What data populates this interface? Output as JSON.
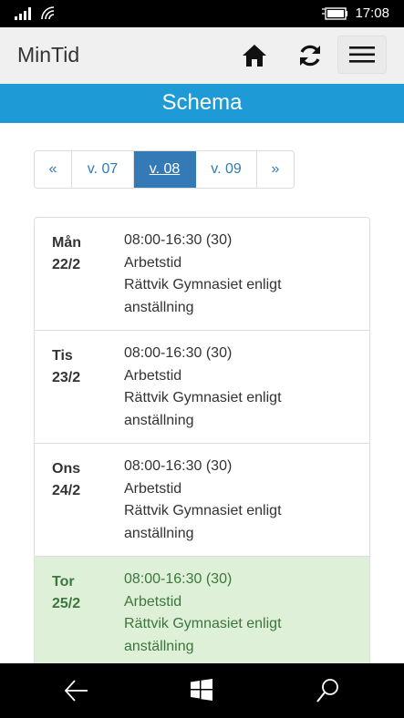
{
  "status_bar": {
    "time": "17:08"
  },
  "navbar": {
    "brand": "MinTid"
  },
  "page_title": "Schema",
  "pagination": {
    "prev": "«",
    "weeks": [
      "v. 07",
      "v. 08",
      "v. 09"
    ],
    "active_week": "v. 08",
    "next": "»"
  },
  "schedule": [
    {
      "day": "Mån",
      "date": "22/2",
      "time": "08:00-16:30 (30)",
      "type": "Arbetstid",
      "location_line1": "Rättvik Gymnasiet enligt",
      "location_line2": "anställning",
      "highlight": false
    },
    {
      "day": "Tis",
      "date": "23/2",
      "time": "08:00-16:30 (30)",
      "type": "Arbetstid",
      "location_line1": "Rättvik Gymnasiet enligt",
      "location_line2": "anställning",
      "highlight": false
    },
    {
      "day": "Ons",
      "date": "24/2",
      "time": "08:00-16:30 (30)",
      "type": "Arbetstid",
      "location_line1": "Rättvik Gymnasiet enligt",
      "location_line2": "anställning",
      "highlight": false
    },
    {
      "day": "Tor",
      "date": "25/2",
      "time": "08:00-16:30 (30)",
      "type": "Arbetstid",
      "location_line1": "Rättvik Gymnasiet enligt",
      "location_line2": "anställning",
      "highlight": true
    }
  ],
  "colors": {
    "title_bar": "#1e9ad6",
    "active_page": "#337ab7",
    "today_bg": "#dff0d8",
    "today_text": "#3c763d"
  },
  "icons": [
    "signal-icon",
    "wifi-icon",
    "battery-icon",
    "home-icon",
    "refresh-icon",
    "hamburger-menu-icon",
    "back-arrow-icon",
    "windows-start-icon",
    "search-icon"
  ]
}
